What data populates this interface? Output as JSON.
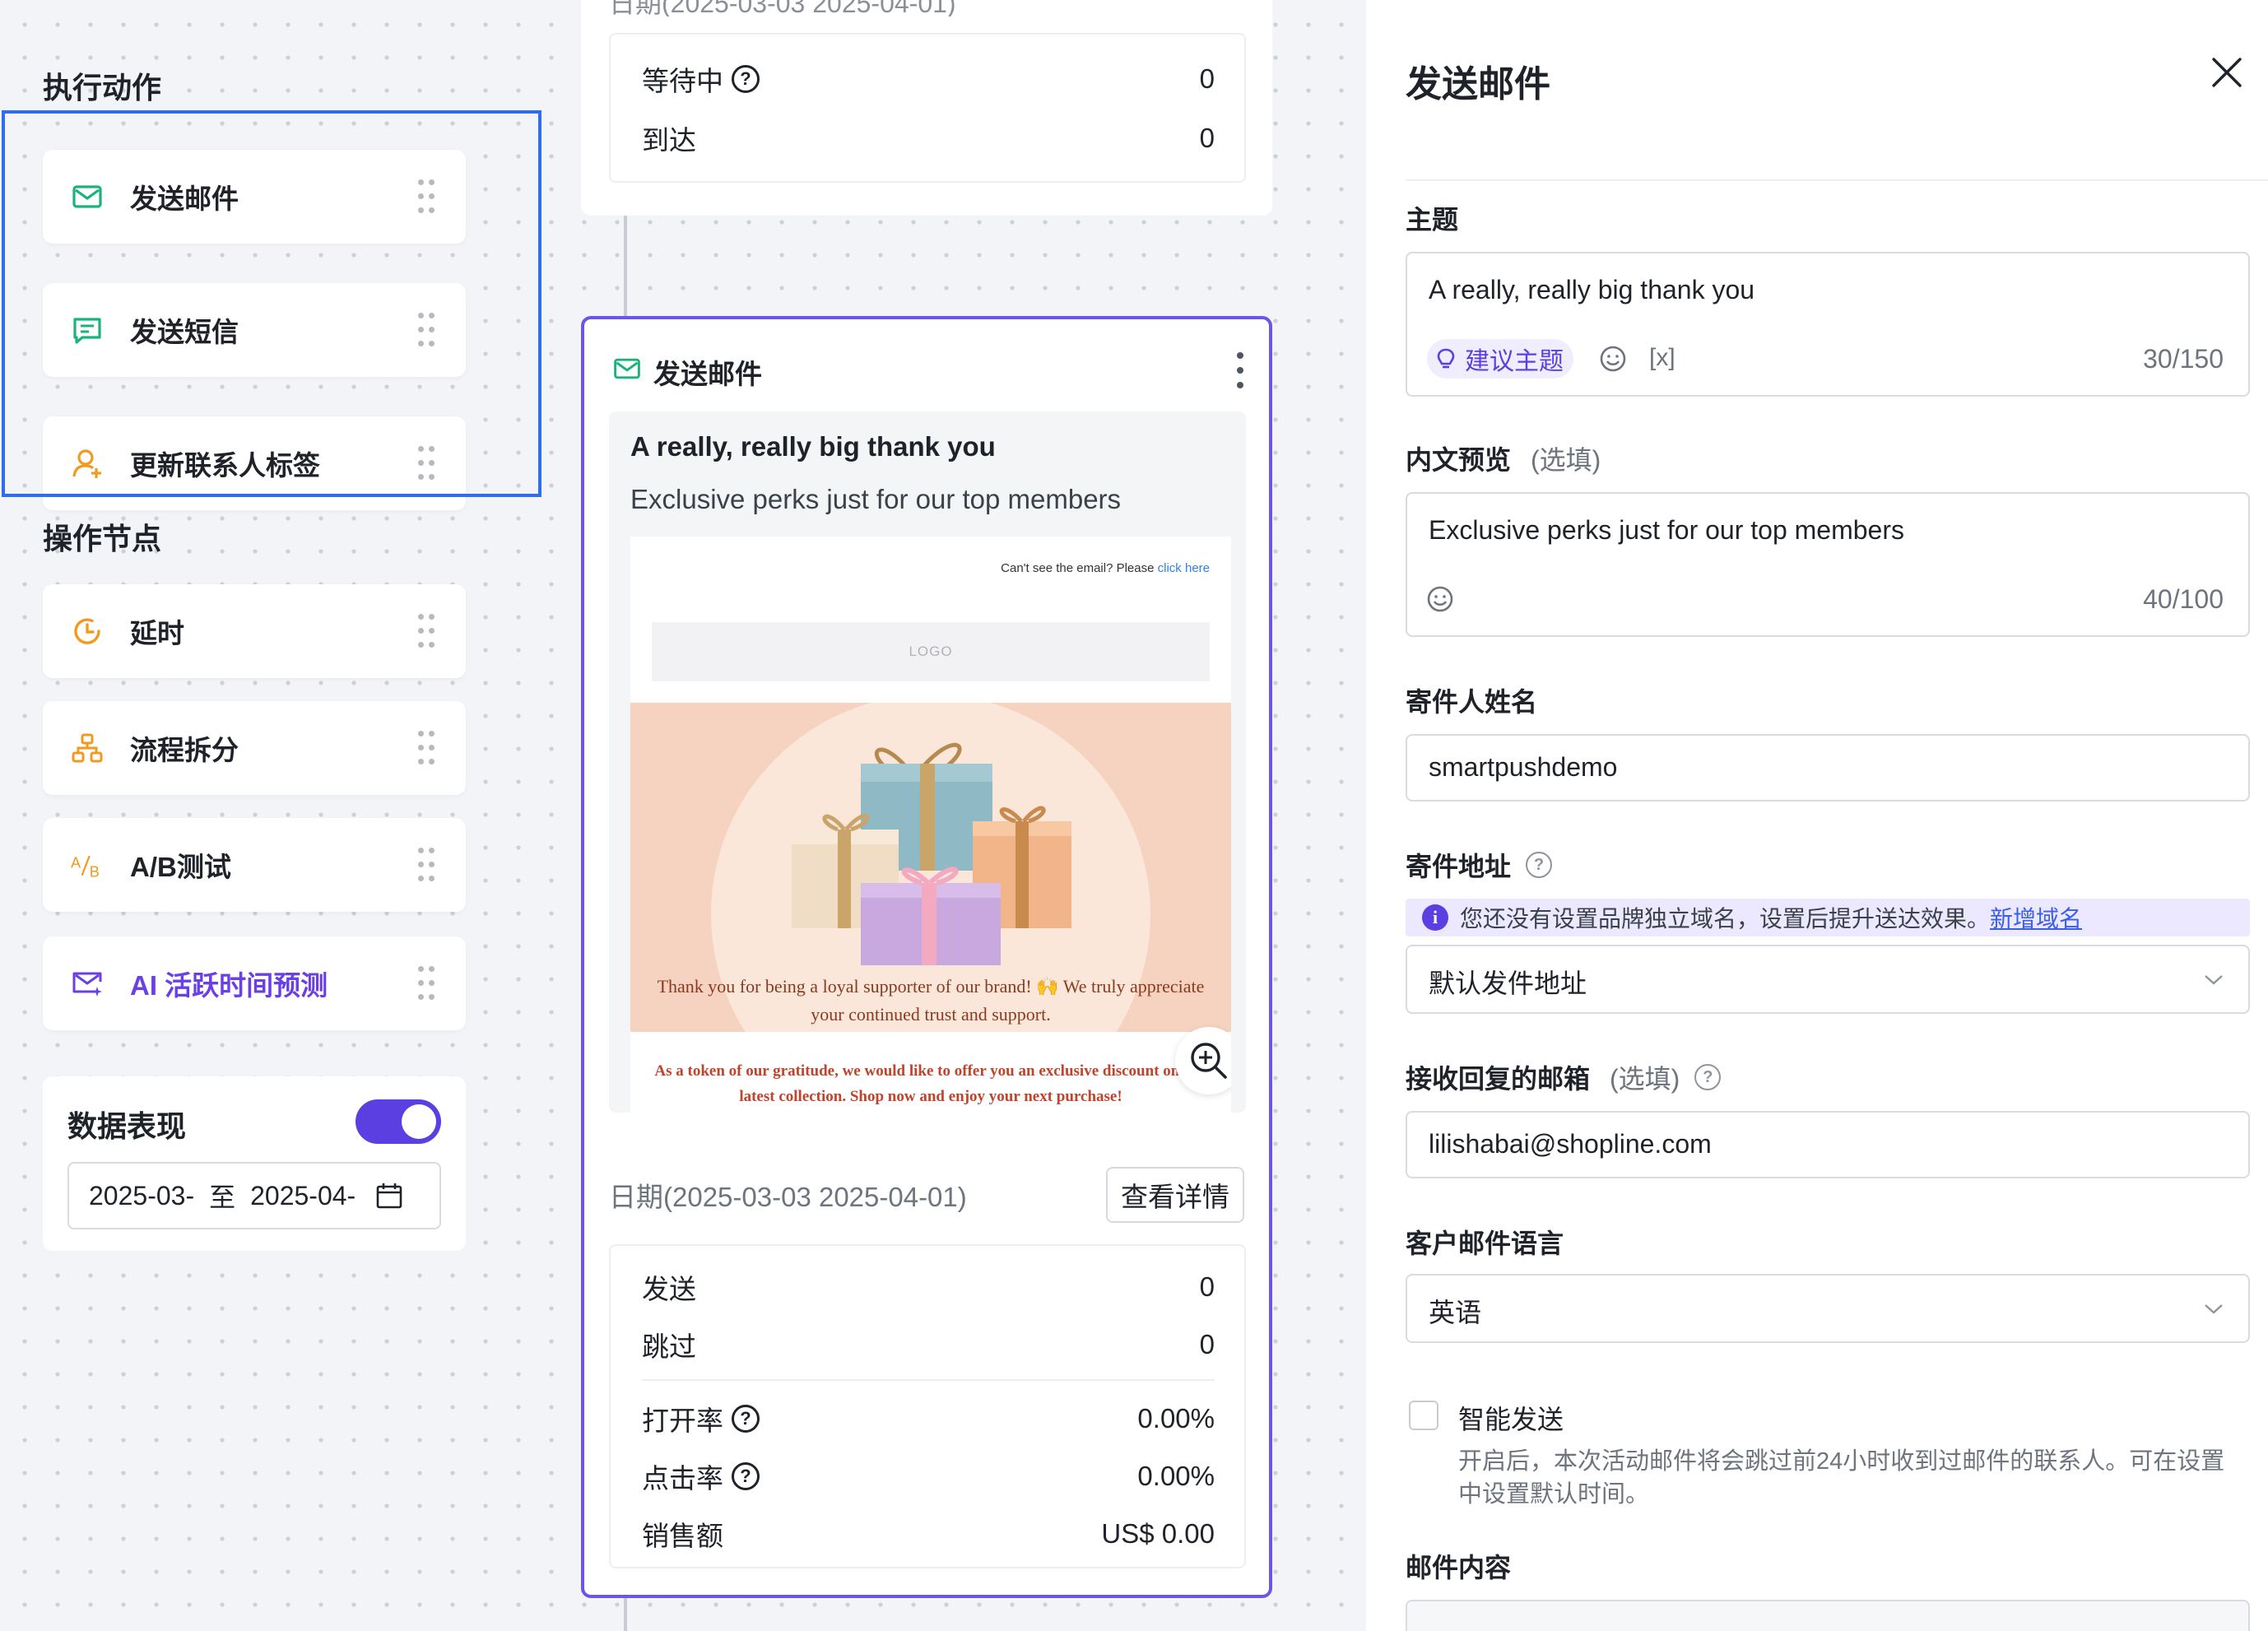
{
  "sidebar": {
    "actions_title": "执行动作",
    "action_items": [
      {
        "label": "发送邮件",
        "icon": "mail-icon"
      },
      {
        "label": "发送短信",
        "icon": "sms-icon"
      },
      {
        "label": "更新联系人标签",
        "icon": "contact-tag-icon"
      }
    ],
    "operations_title": "操作节点",
    "operation_items": [
      {
        "label": "延时",
        "icon": "clock-icon"
      },
      {
        "label": "流程拆分",
        "icon": "split-icon"
      },
      {
        "label": "A/B测试",
        "icon": "ab-test-icon"
      },
      {
        "label": "AI 活跃时间预测",
        "icon": "ai-mail-icon"
      }
    ],
    "data_card": {
      "title": "数据表现",
      "toggle_on": true,
      "date_start": "2025-03-",
      "date_sep": "至",
      "date_end": "2025-04-"
    }
  },
  "flow": {
    "top_node": {
      "clipped_text": "日期(2025-03-03 2025-04-01)",
      "stats": [
        {
          "label": "等待中",
          "value": "0",
          "help": true
        },
        {
          "label": "到达",
          "value": "0",
          "help": false
        }
      ]
    },
    "email_node": {
      "title": "发送邮件",
      "subject": "A really, really big thank you",
      "preheader": "Exclusive perks just for our top members",
      "mail_preview": {
        "cant_see": "Can't see the email? Please ",
        "click_here": "click here",
        "logo": "LOGO",
        "thanks_text": "Thank you for being a loyal supporter of our brand! 🙌 We truly appreciate your continued trust and support.",
        "token_text": "As a token of our gratitude, we would like to offer you an exclusive discount on our latest collection. Shop now and enjoy your next purchase!"
      },
      "date_range": "日期(2025-03-03 2025-04-01)",
      "detail_button": "查看详情",
      "stats_top": [
        {
          "label": "发送",
          "value": "0"
        },
        {
          "label": "跳过",
          "value": "0"
        }
      ],
      "stats_bottom": [
        {
          "label": "打开率",
          "value": "0.00%",
          "help": true
        },
        {
          "label": "点击率",
          "value": "0.00%",
          "help": true
        },
        {
          "label": "销售额",
          "value": "US$ 0.00",
          "help": false
        }
      ]
    }
  },
  "panel": {
    "title": "发送邮件",
    "subject_label": "主题",
    "subject_value": "A really, really big thank you",
    "suggest_label": "建议主题",
    "var_token": "[x]",
    "subject_count": "30/150",
    "preview_label": "内文预览",
    "optional": "(选填)",
    "preview_value": "Exclusive perks just for our top members",
    "preview_count": "40/100",
    "sender_name_label": "寄件人姓名",
    "sender_name_value": "smartpushdemo",
    "sender_addr_label": "寄件地址",
    "notice_text": "您还没有设置品牌独立域名，设置后提升送达效果。",
    "notice_link": "新增域名",
    "sender_addr_value": "默认发件地址",
    "reply_label": "接收回复的邮箱",
    "reply_value": "lilishabai@shopline.com",
    "lang_label": "客户邮件语言",
    "lang_value": "英语",
    "smart_send_label": "智能发送",
    "smart_send_desc": "开启后，本次活动邮件将会跳过前24小时收到过邮件的联系人。可在设置中设置默认时间。",
    "content_label": "邮件内容"
  },
  "colors": {
    "accent": "#5b3fe0",
    "highlight_border": "#2f6ee8",
    "mail_green": "#19b37b",
    "orange": "#f29a1f"
  }
}
